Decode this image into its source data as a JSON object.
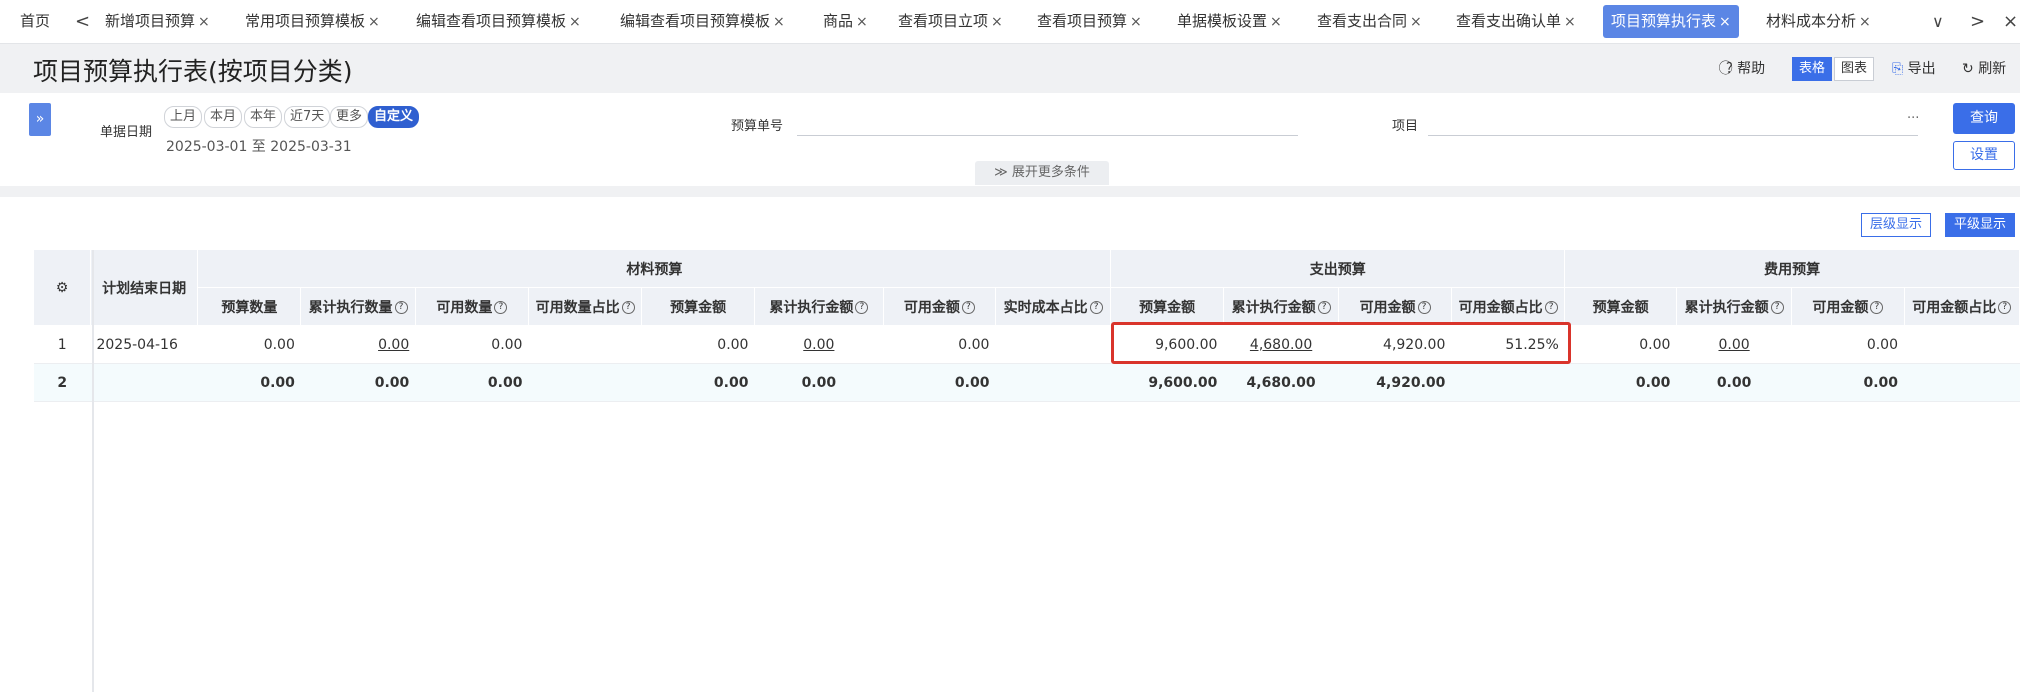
{
  "tabs": {
    "home": "首页",
    "prev": "<",
    "items": [
      "新增项目预算",
      "常用项目预算模板",
      "编辑查看项目预算模板",
      "编辑查看项目预算模板",
      "商品",
      "查看项目立项",
      "查看项目预算",
      "单据模板设置",
      "查看支出合同",
      "查看支出确认单",
      "项目预算执行表",
      "材料成本分析"
    ],
    "close": "×",
    "dropdown": "∨",
    "next": ">",
    "close_all": "×"
  },
  "title": "项目预算执行表(按项目分类)",
  "title_actions": {
    "help": "帮助",
    "table": "表格",
    "chart": "图表",
    "export": "导出",
    "refresh": "刷新"
  },
  "filter": {
    "expand_icon": "»",
    "date_label": "单据日期",
    "date_chips": [
      "上月",
      "本月",
      "本年",
      "近7天",
      "更多",
      "自定义"
    ],
    "date_range": "2025-03-01 至 2025-03-31",
    "budget_no_label": "预算单号",
    "project_label": "项目",
    "project_more": "···",
    "query": "查询",
    "settings": "设置",
    "more_conditions": "展开更多条件"
  },
  "view_toggle": {
    "hierarchy": "层级显示",
    "flat": "平级显示"
  },
  "table": {
    "settings_icon": "⚙",
    "col_end_date": "计划结束日期",
    "groups": [
      "材料预算",
      "支出预算",
      "费用预算"
    ],
    "cols_material": [
      "预算数量",
      "累计执行数量",
      "可用数量",
      "可用数量占比",
      "预算金额",
      "累计执行金额",
      "可用金额",
      "实时成本占比"
    ],
    "cols_expense": [
      "预算金额",
      "累计执行金额",
      "可用金额",
      "可用金额占比"
    ],
    "cols_fee": [
      "预算金额",
      "累计执行金额",
      "可用金额",
      "可用金额占比"
    ],
    "help_mark": "?",
    "rows": [
      {
        "no": "1",
        "date": "2025-04-16",
        "m": [
          "0.00",
          "0.00",
          "0.00",
          "",
          "0.00",
          "0.00",
          "0.00",
          ""
        ],
        "e": [
          "9,600.00",
          "4,680.00",
          "4,920.00",
          "51.25%"
        ],
        "f": [
          "0.00",
          "0.00",
          "0.00",
          ""
        ]
      },
      {
        "no": "2",
        "date": "",
        "m": [
          "0.00",
          "0.00",
          "0.00",
          "",
          "0.00",
          "0.00",
          "0.00",
          ""
        ],
        "e": [
          "9,600.00",
          "4,680.00",
          "4,920.00",
          ""
        ],
        "f": [
          "0.00",
          "0.00",
          "0.00",
          ""
        ]
      }
    ]
  },
  "colors": {
    "accent": "#3a6ee8",
    "tab_active": "#5b86e5",
    "highlight": "#d9342b"
  }
}
